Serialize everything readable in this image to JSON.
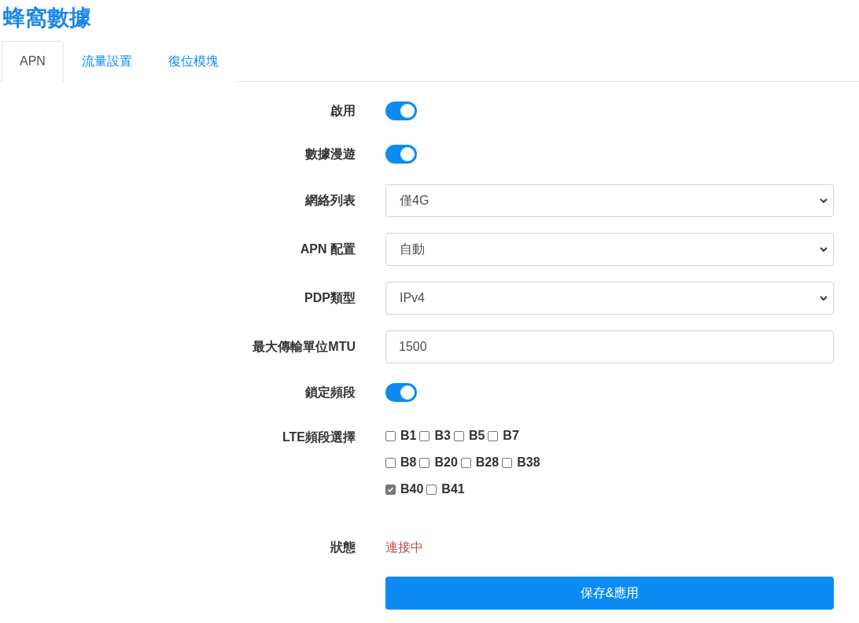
{
  "title": "蜂窩數據",
  "tabs": [
    {
      "label": "APN",
      "selected": true
    },
    {
      "label": "流量設置",
      "selected": false
    },
    {
      "label": "復位模塊",
      "selected": false
    }
  ],
  "fields": [
    {
      "kind": "toggle",
      "label": "啟用",
      "on": true
    },
    {
      "kind": "toggle",
      "label": "數據漫遊",
      "on": true
    },
    {
      "kind": "select",
      "label": "網絡列表",
      "value": "僅4G"
    },
    {
      "kind": "select",
      "label": "APN 配置",
      "value": "自動"
    },
    {
      "kind": "select",
      "label": "PDP類型",
      "value": "IPv4"
    },
    {
      "kind": "input",
      "label": "最大傳輸單位MTU",
      "value": "1500"
    },
    {
      "kind": "toggle",
      "label": "鎖定頻段",
      "on": true
    },
    {
      "kind": "bands",
      "label": "LTE頻段選擇",
      "rows": [
        [
          {
            "label": "B1",
            "checked": false
          },
          {
            "label": "B3",
            "checked": false
          },
          {
            "label": "B5",
            "checked": false
          },
          {
            "label": "B7",
            "checked": false
          }
        ],
        [
          {
            "label": "B8",
            "checked": false
          },
          {
            "label": "B20",
            "checked": false
          },
          {
            "label": "B28",
            "checked": false
          },
          {
            "label": "B38",
            "checked": false
          }
        ],
        [
          {
            "label": "B40",
            "checked": true
          },
          {
            "label": "B41",
            "checked": false
          }
        ]
      ]
    },
    {
      "kind": "status",
      "label": "狀態",
      "value": "連接中"
    }
  ],
  "save_button": "保存&應用"
}
